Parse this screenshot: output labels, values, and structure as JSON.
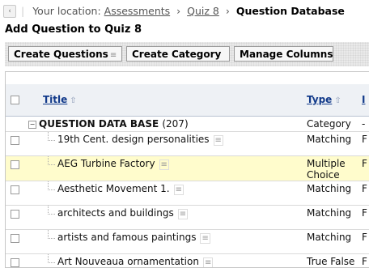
{
  "breadcrumb": {
    "prefix": "Your location:",
    "items": [
      "Assessments",
      "Quiz 8"
    ],
    "current": "Question Database"
  },
  "page": {
    "title": "Add Question to Quiz 8"
  },
  "toolbar": {
    "create_questions": "Create Questions",
    "create_category": "Create Category",
    "manage_columns": "Manage Columns"
  },
  "table": {
    "headers": {
      "title": "Title",
      "type": "Type",
      "last": "I"
    },
    "category": {
      "name": "QUESTION DATA BASE",
      "count": "(207)",
      "type": "Category",
      "last": "-"
    },
    "rows": [
      {
        "title": "19th Cent. design personalities",
        "type": "Matching",
        "last": "F"
      },
      {
        "title": "AEG Turbine Factory",
        "type": "Multiple Choice",
        "last": "F"
      },
      {
        "title": "Aesthetic Movement 1.",
        "type": "Matching",
        "last": "F"
      },
      {
        "title": "architects and buildings",
        "type": "Matching",
        "last": "F"
      },
      {
        "title": "artists and famous paintings",
        "type": "Matching",
        "last": "F"
      },
      {
        "title": "Art Nouveaua ornamentation",
        "type": "True False",
        "last": "F"
      }
    ]
  }
}
